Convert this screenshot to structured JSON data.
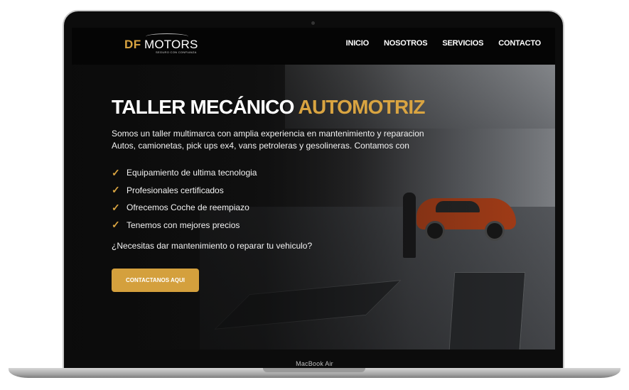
{
  "nav": {
    "logo": {
      "brand_df": "DF",
      "brand_motors": "MOTORS",
      "tagline": "SEGURO CON CONFIANZA"
    },
    "menu": [
      "INICIO",
      "NOSOTROS",
      "SERVICIOS",
      "CONTACTO"
    ]
  },
  "hero": {
    "title_main": "TALLER MECÁNICO",
    "title_accent": "AUTOMOTRIZ",
    "description": "Somos un taller multimarca con amplia experiencia en mantenimiento y reparacion Autos, camionetas, pick ups ex4, vans petroleras y gesolineras. Contamos con",
    "features": [
      "Equipamiento de ultima tecnologia",
      "Profesionales certificados",
      "Ofrecemos Coche de reempiazo",
      "Tenemos con mejores precios"
    ],
    "question": "¿Necesitas dar mantenimiento o reparar tu vehiculo?",
    "cta_label": "CONTACTANOS AQUI"
  },
  "device": {
    "label": "MacBook Air"
  },
  "colors": {
    "accent": "#d9a441",
    "button": "#d4a03d",
    "nav_bg": "#050505"
  },
  "icons": {
    "feature": "check-icon"
  }
}
